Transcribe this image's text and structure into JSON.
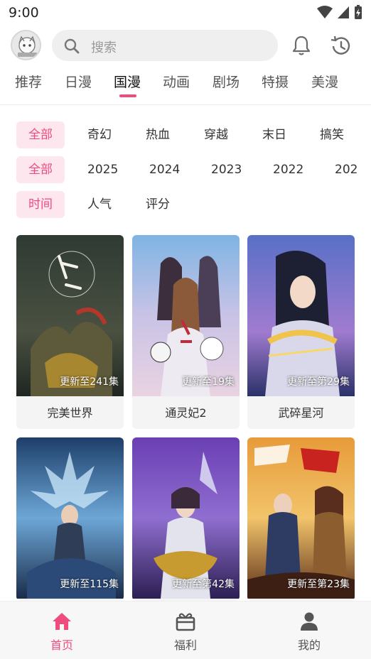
{
  "status": {
    "time": "9:00"
  },
  "header": {
    "search_placeholder": "搜索"
  },
  "tabs": [
    {
      "label": "推荐",
      "active": false
    },
    {
      "label": "日漫",
      "active": false
    },
    {
      "label": "国漫",
      "active": true
    },
    {
      "label": "动画",
      "active": false
    },
    {
      "label": "剧场",
      "active": false
    },
    {
      "label": "特摄",
      "active": false
    },
    {
      "label": "美漫",
      "active": false
    }
  ],
  "filters": {
    "genre": [
      "全部",
      "奇幻",
      "热血",
      "穿越",
      "末日",
      "搞笑"
    ],
    "year": [
      "全部",
      "2025",
      "2024",
      "2023",
      "2022",
      "202"
    ],
    "sort": [
      "时间",
      "人气",
      "评分"
    ]
  },
  "cards": [
    {
      "title": "完美世界",
      "update": "更新至241集"
    },
    {
      "title": "通灵妃2",
      "update": "更新至19集"
    },
    {
      "title": "武碎星河",
      "update": "更新至第29集"
    },
    {
      "title": "",
      "update": "更新至115集"
    },
    {
      "title": "",
      "update": "更新至第42集"
    },
    {
      "title": "",
      "update": "更新至第23集"
    }
  ],
  "nav": [
    {
      "label": "首页",
      "icon": "home-icon",
      "active": true
    },
    {
      "label": "福利",
      "icon": "gift-icon",
      "active": false
    },
    {
      "label": "我的",
      "icon": "user-icon",
      "active": false
    }
  ],
  "colors": {
    "accent": "#ef4b7c",
    "accent_bg": "#fde6ee"
  }
}
